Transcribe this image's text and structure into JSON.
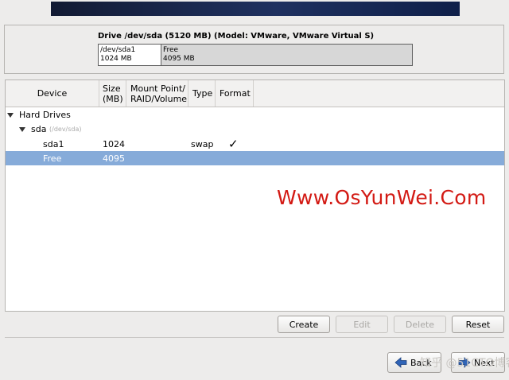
{
  "drive": {
    "title": "Drive /dev/sda (5120 MB) (Model: VMware, VMware Virtual S)",
    "segments": [
      {
        "name": "/dev/sda1",
        "size": "1024 MB"
      },
      {
        "name": "Free",
        "size": "4095 MB"
      }
    ]
  },
  "table": {
    "headers": {
      "device": "Device",
      "size_l1": "Size",
      "size_l2": "(MB)",
      "mount_l1": "Mount Point/",
      "mount_l2": "RAID/Volume",
      "type": "Type",
      "format": "Format"
    },
    "group": "Hard Drives",
    "disk": {
      "name": "sda",
      "path": "(/dev/sda)"
    },
    "rows": [
      {
        "device": "sda1",
        "size": "1024",
        "mount": "",
        "type": "swap",
        "format": "✓"
      },
      {
        "device": "Free",
        "size": "4095",
        "mount": "",
        "type": "",
        "format": ""
      }
    ]
  },
  "watermark": "Www.OsYunWei.Com",
  "buttons": {
    "create": "Create",
    "edit": "Edit",
    "delete": "Delete",
    "reset": "Reset"
  },
  "nav": {
    "back": "Back",
    "next": "Next"
  },
  "zh_watermark": "知乎 @51CTO博客",
  "colors": {
    "selection": "#86abd9",
    "watermark": "#d31a14",
    "banner": "#1f3160"
  },
  "icons": {
    "back": "arrow-left-icon",
    "next": "arrow-right-icon"
  }
}
